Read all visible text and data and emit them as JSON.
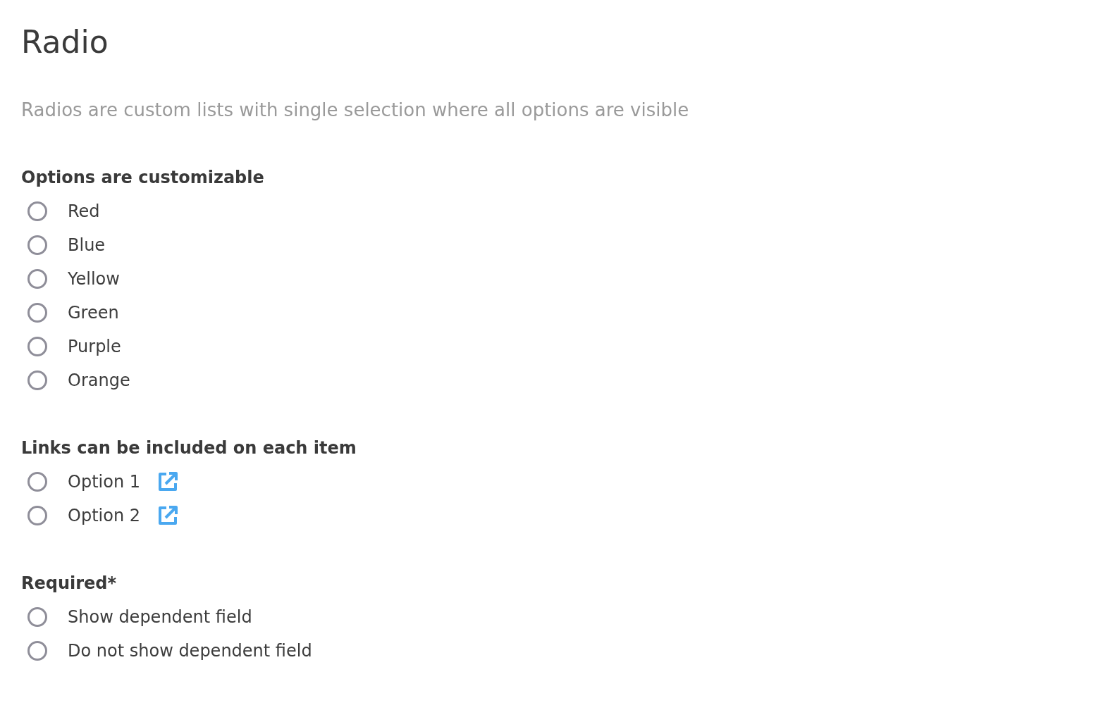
{
  "title": "Radio",
  "description": "Radios are custom lists with single selection where all options are visible",
  "groups": [
    {
      "heading": "Options are customizable",
      "options": [
        {
          "label": "Red",
          "selected": false
        },
        {
          "label": "Blue",
          "selected": false
        },
        {
          "label": "Yellow",
          "selected": false
        },
        {
          "label": "Green",
          "selected": false
        },
        {
          "label": "Purple",
          "selected": false
        },
        {
          "label": "Orange",
          "selected": false
        }
      ]
    },
    {
      "heading": "Links can be included on each item",
      "options": [
        {
          "label": "Option 1",
          "selected": false,
          "link": true
        },
        {
          "label": "Option 2",
          "selected": false,
          "link": true
        }
      ]
    },
    {
      "heading": "Required*",
      "options": [
        {
          "label": "Show dependent field",
          "selected": false
        },
        {
          "label": "Do not show dependent field",
          "selected": false
        }
      ]
    }
  ]
}
